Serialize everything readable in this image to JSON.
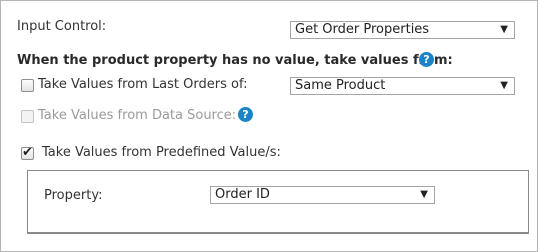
{
  "input_control": {
    "label": "Input Control:",
    "selected": "Get Order Properties"
  },
  "section_title": "When the product property has no value, take values from:",
  "last_orders": {
    "checked": false,
    "label": "Take Values from Last Orders of:",
    "selected": "Same Product"
  },
  "data_source": {
    "checked": false,
    "disabled": true,
    "label": "Take Values from Data Source:"
  },
  "predefined": {
    "checked": true,
    "label": "Take Values from Predefined Value/s:",
    "property_label": "Property:",
    "property_selected": "Order ID"
  },
  "icons": {
    "help": "help-icon",
    "dropdown": "chevron-down-icon",
    "check": "checkmark-icon"
  },
  "help_glyph": "?",
  "arrow_glyph": "▼",
  "check_glyph": "✔",
  "colors": {
    "help_icon": "#1c84c6",
    "disabled_text": "#9a9a9a",
    "border": "#a5a5a5"
  }
}
